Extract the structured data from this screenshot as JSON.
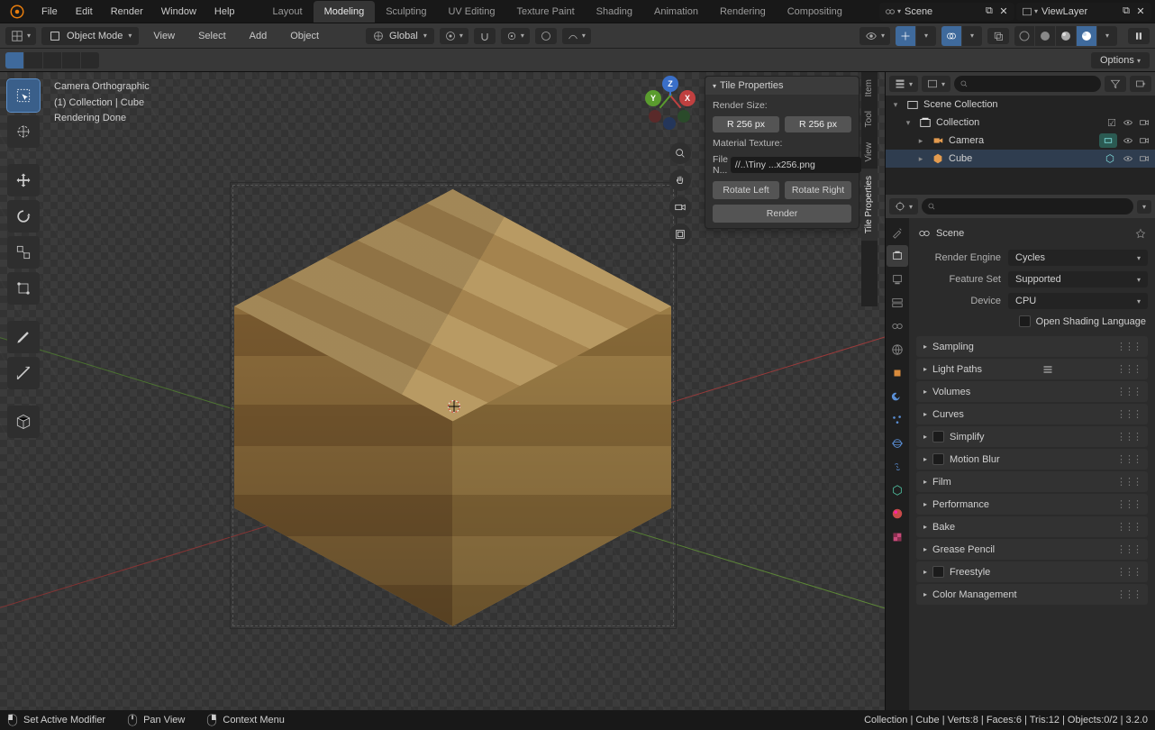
{
  "topbar": {
    "menus": [
      "File",
      "Edit",
      "Render",
      "Window",
      "Help"
    ],
    "workspaces": [
      "Layout",
      "Modeling",
      "Sculpting",
      "UV Editing",
      "Texture Paint",
      "Shading",
      "Animation",
      "Rendering",
      "Compositing"
    ],
    "active_workspace": "Modeling",
    "scene_label": "Scene",
    "viewlayer_label": "ViewLayer"
  },
  "header3d": {
    "mode": "Object Mode",
    "menus": [
      "View",
      "Select",
      "Add",
      "Object"
    ],
    "orientation": "Global",
    "options_btn": "Options"
  },
  "viewport": {
    "info1": "Camera Orthographic",
    "info2": "(1) Collection | Cube",
    "info3": "Rendering Done"
  },
  "npanel": {
    "title": "Tile Properties",
    "render_size_label": "Render Size:",
    "render_size_r1": "R  256 px",
    "render_size_r2": "R  256 px",
    "mat_tex_label": "Material Texture:",
    "file_label": "File N...",
    "file_value": "//..\\Tiny ...x256.png",
    "rotate_left": "Rotate Left",
    "rotate_right": "Rotate Right",
    "render_btn": "Render",
    "tabs": [
      "Item",
      "Tool",
      "View",
      "Tile Properties"
    ],
    "active_tab": "Tile Properties"
  },
  "gizmo_axes": {
    "x": "X",
    "y": "Y",
    "z": "Z"
  },
  "outliner": {
    "root": "Scene Collection",
    "collection": "Collection",
    "items": [
      {
        "name": "Camera",
        "icon": "camera",
        "selected": false
      },
      {
        "name": "Cube",
        "icon": "mesh",
        "selected": true
      }
    ]
  },
  "properties": {
    "breadcrumb": "Scene",
    "engine_label": "Render Engine",
    "engine_value": "Cycles",
    "feature_label": "Feature Set",
    "feature_value": "Supported",
    "device_label": "Device",
    "device_value": "CPU",
    "osl_label": "Open Shading Language",
    "panels": [
      "Sampling",
      "Light Paths",
      "Volumes",
      "Curves",
      "Simplify",
      "Motion Blur",
      "Film",
      "Performance",
      "Bake",
      "Grease Pencil",
      "Freestyle",
      "Color Management"
    ],
    "checkbox_panels": [
      "Simplify",
      "Motion Blur",
      "Freestyle"
    ]
  },
  "statusbar": {
    "left1": "Set Active Modifier",
    "left2": "Pan View",
    "left3": "Context Menu",
    "right": "Collection | Cube | Verts:8 | Faces:6 | Tris:12 | Objects:0/2 | 3.2.0"
  }
}
